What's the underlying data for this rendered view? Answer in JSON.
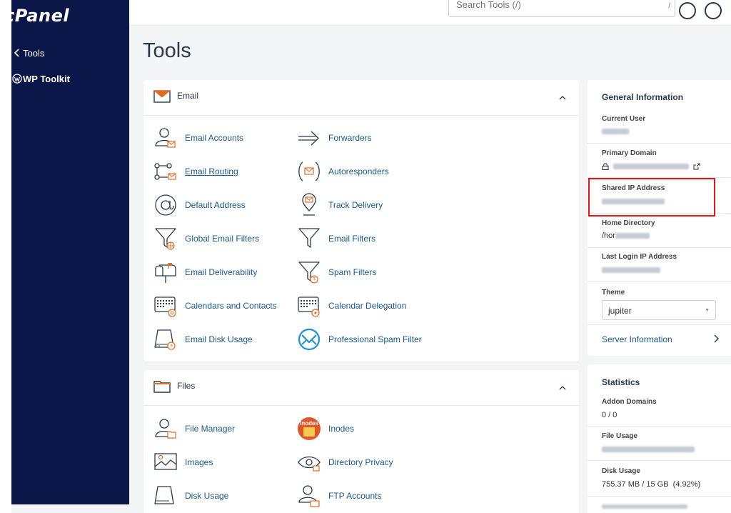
{
  "app": {
    "logo": "cPanel"
  },
  "sidebar": {
    "items": [
      {
        "label": "Tools",
        "icon": "chevron-left-icon"
      },
      {
        "label": "WP Toolkit",
        "icon": "wordpress-icon"
      }
    ]
  },
  "topbar": {
    "search_placeholder": "Search Tools (/)",
    "search_shortcut": "/"
  },
  "page": {
    "title": "Tools"
  },
  "email_section": {
    "title": "Email",
    "tools_left": [
      {
        "label": "Email Accounts",
        "icon": "email-accounts-icon"
      },
      {
        "label": "Email Routing",
        "icon": "email-routing-icon"
      },
      {
        "label": "Default Address",
        "icon": "at-sign-icon"
      },
      {
        "label": "Global Email Filters",
        "icon": "global-filter-icon"
      },
      {
        "label": "Email Deliverability",
        "icon": "mailbox-icon"
      },
      {
        "label": "Calendars and Contacts",
        "icon": "calendar-at-icon"
      },
      {
        "label": "Email Disk Usage",
        "icon": "disk-usage-icon"
      }
    ],
    "tools_right": [
      {
        "label": "Forwarders",
        "icon": "forward-arrow-icon"
      },
      {
        "label": "Autoresponders",
        "icon": "autoresponder-icon"
      },
      {
        "label": "Track Delivery",
        "icon": "track-delivery-icon"
      },
      {
        "label": "Email Filters",
        "icon": "filter-icon"
      },
      {
        "label": "Spam Filters",
        "icon": "spam-filter-icon"
      },
      {
        "label": "Calendar Delegation",
        "icon": "calendar-delegation-icon"
      },
      {
        "label": "Professional Spam Filter",
        "icon": "envelope-circle-icon"
      }
    ]
  },
  "files_section": {
    "title": "Files",
    "tools_left": [
      {
        "label": "File Manager",
        "icon": "file-manager-icon"
      },
      {
        "label": "Images",
        "icon": "images-icon"
      },
      {
        "label": "Disk Usage",
        "icon": "disk-usage-icon"
      }
    ],
    "tools_right": [
      {
        "label": "Inodes",
        "icon": "inodes-icon",
        "badge": "Inodes"
      },
      {
        "label": "Directory Privacy",
        "icon": "eye-icon"
      },
      {
        "label": "FTP Accounts",
        "icon": "ftp-accounts-icon"
      }
    ]
  },
  "general_info": {
    "title": "General Information",
    "current_user_label": "Current User",
    "primary_domain_label": "Primary Domain",
    "shared_ip_label": "Shared IP Address",
    "home_dir_label": "Home Directory",
    "home_dir_value_prefix": "/hor",
    "last_login_label": "Last Login IP Address",
    "theme_label": "Theme",
    "theme_value": "jupiter",
    "server_info_label": "Server Information"
  },
  "statistics": {
    "title": "Statistics",
    "addon_domains_label": "Addon Domains",
    "addon_domains_value": "0 / 0",
    "file_usage_label": "File Usage",
    "disk_usage_label": "Disk Usage",
    "disk_usage_value": "755.37 MB / 15 GB  (4.92%)"
  },
  "colors": {
    "sidebar": "#0c1749",
    "link": "#1a5a8e",
    "accent_orange": "#e76a24",
    "highlight": "#e8141b"
  }
}
